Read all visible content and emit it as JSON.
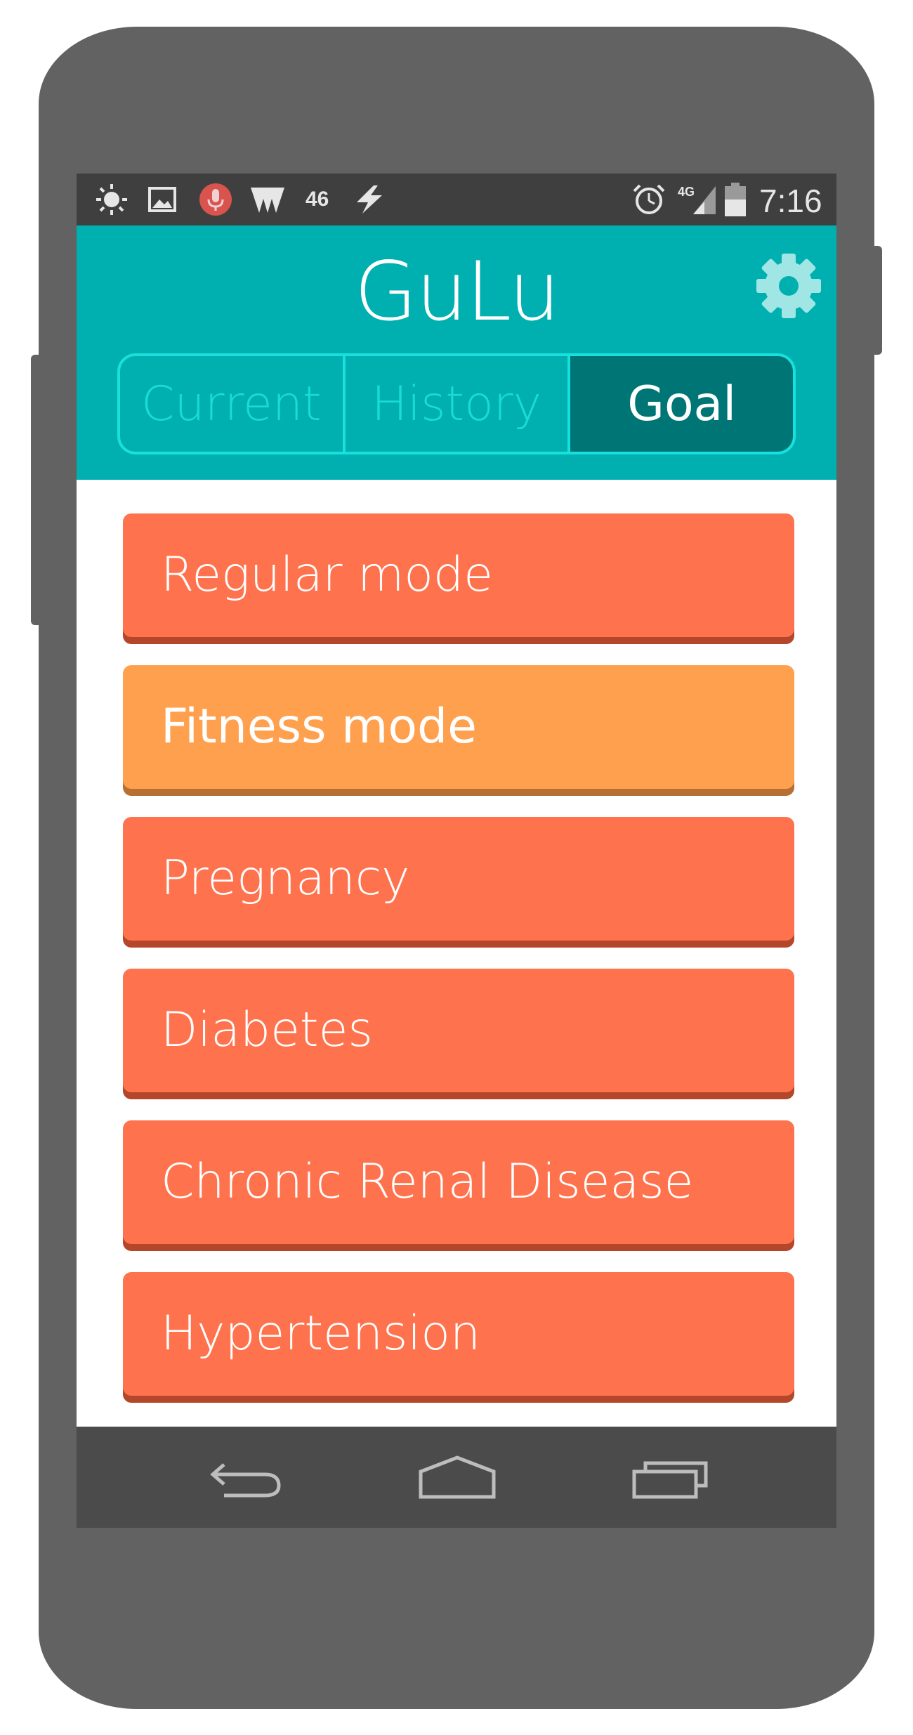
{
  "status_bar": {
    "icons": [
      "weather-icon",
      "image-icon",
      "mic-icon",
      "signal-wave-icon",
      "network-46-icon",
      "charging-bolt-icon",
      "alarm-icon",
      "4g-signal-icon",
      "battery-icon"
    ],
    "network_label": "46",
    "lte_label": "4G",
    "time": "7:16"
  },
  "app": {
    "title": "GuLu",
    "settings_icon": "gear-icon"
  },
  "tabs": [
    {
      "label": "Current",
      "active": false
    },
    {
      "label": "History",
      "active": false
    },
    {
      "label": "Goal",
      "active": true
    }
  ],
  "goals": [
    {
      "label": "Regular mode",
      "selected": false
    },
    {
      "label": "Fitness mode",
      "selected": true
    },
    {
      "label": "Pregnancy",
      "selected": false
    },
    {
      "label": "Diabetes",
      "selected": false
    },
    {
      "label": "Chronic Renal Disease",
      "selected": false
    },
    {
      "label": "Hypertension",
      "selected": false
    }
  ],
  "navigation": {
    "icons": [
      "back-icon",
      "home-icon",
      "recents-icon"
    ]
  },
  "colors": {
    "header": "#00b0b0",
    "tab_active": "#007575",
    "tab_border": "#18e0dc",
    "goal_default": "#ff724e",
    "goal_default_shadow": "#b4462a",
    "goal_selected": "#ffa04e",
    "goal_selected_shadow": "#b86f33",
    "gear": "#9fe6e4"
  }
}
